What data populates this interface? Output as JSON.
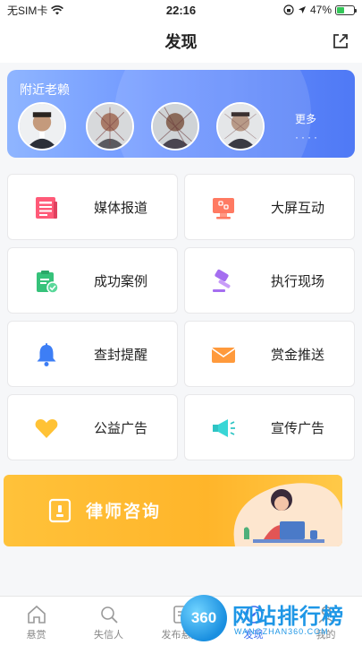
{
  "status": {
    "carrier": "无SIM卡",
    "time": "22:16",
    "battery": "47%",
    "battery_level": 0.47
  },
  "header": {
    "title": "发现"
  },
  "nearby": {
    "title": "附近老赖",
    "more_label": "更多",
    "more_dots": "····"
  },
  "grid": [
    {
      "label": "媒体报道",
      "icon": "newspaper-icon"
    },
    {
      "label": "大屏互动",
      "icon": "screen-icon"
    },
    {
      "label": "成功案例",
      "icon": "clipboard-check-icon"
    },
    {
      "label": "执行现场",
      "icon": "gavel-icon"
    },
    {
      "label": "查封提醒",
      "icon": "bell-icon"
    },
    {
      "label": "赏金推送",
      "icon": "envelope-icon"
    },
    {
      "label": "公益广告",
      "icon": "heart-icon"
    },
    {
      "label": "宣传广告",
      "icon": "megaphone-icon"
    }
  ],
  "lawyer_banner": {
    "text": "律师咨询"
  },
  "tabs": [
    {
      "label": "悬赏",
      "icon": "home-icon"
    },
    {
      "label": "失信人",
      "icon": "search-icon"
    },
    {
      "label": "发布悬赏",
      "icon": "publish-icon"
    },
    {
      "label": "发现",
      "icon": "discover-icon"
    },
    {
      "label": "我的",
      "icon": "profile-icon"
    }
  ],
  "watermark": {
    "logo": "360",
    "text": "网站排行榜",
    "sub": "WANGZHAN360.COM"
  },
  "colors": {
    "accent": "#3b6cf0",
    "banner": "#5b83f7",
    "lawyer": "#ffb52a"
  }
}
